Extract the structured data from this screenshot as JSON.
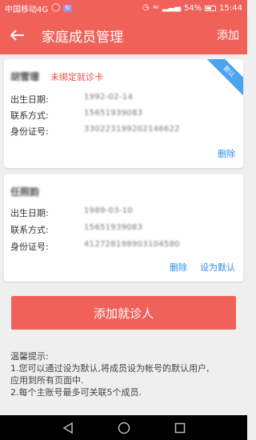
{
  "status_bar": {
    "carrier": "中国移动4G",
    "badge": "Si",
    "battery_text": "54%",
    "battery_level": 0.54,
    "time": "15:44"
  },
  "header": {
    "title": "家庭成员管理",
    "add_label": "添加"
  },
  "members": [
    {
      "name": "胡雪珊",
      "warning": "未绑定就诊卡",
      "is_default": true,
      "default_label": "默认",
      "fields": [
        {
          "label": "出生日期:",
          "value": "1992-02-14"
        },
        {
          "label": "联系方式:",
          "value": "15651939083"
        },
        {
          "label": "身份证号:",
          "value": "330223199202146622"
        }
      ],
      "actions": [
        "删除"
      ]
    },
    {
      "name": "任照韵",
      "warning": "",
      "is_default": false,
      "fields": [
        {
          "label": "出生日期:",
          "value": "1989-03-10"
        },
        {
          "label": "联系方式:",
          "value": "15651939083"
        },
        {
          "label": "身份证号:",
          "value": "412728198903104580"
        }
      ],
      "actions": [
        "删除",
        "设为默认"
      ]
    }
  ],
  "add_patient_label": "添加就诊人",
  "tips": {
    "title": "温馨提示:",
    "line1": " 1.您可以通过设为默认,将成员设为帐号的默认用户,",
    "line2": "应用到所有页面中.",
    "line3": "2.每个主账号最多可关联5个成员."
  },
  "colors": {
    "accent": "#f0615a",
    "link": "#2a8ee6",
    "ribbon": "#4aa3f0"
  }
}
